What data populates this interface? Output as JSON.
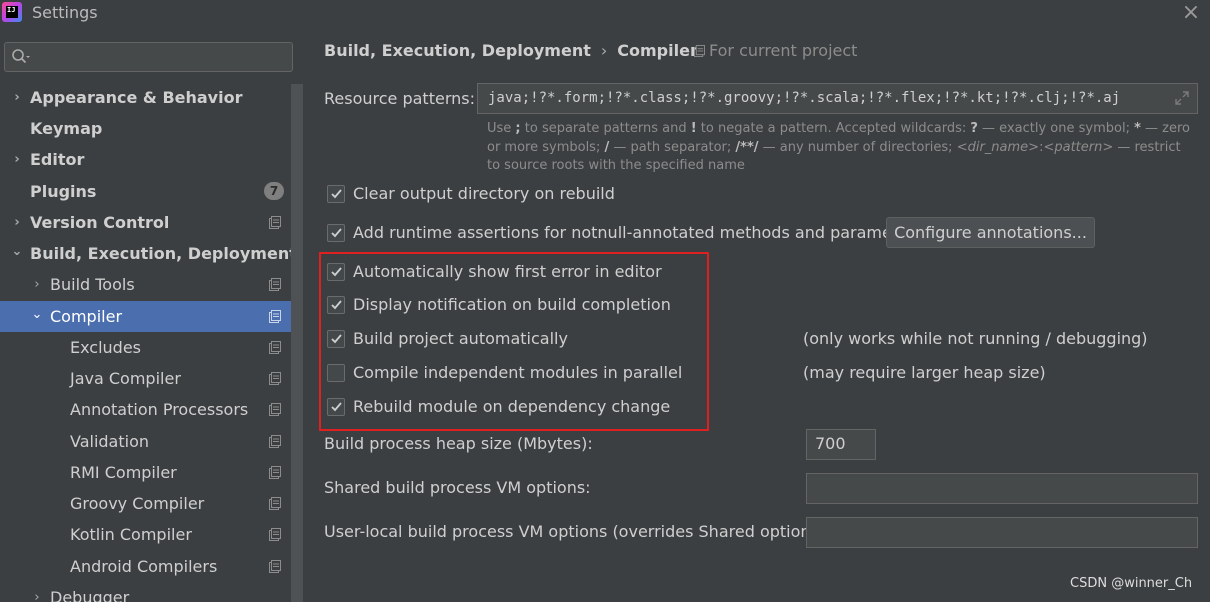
{
  "window": {
    "title": "Settings",
    "app_icon_text": "IJ"
  },
  "search": {
    "placeholder": ""
  },
  "sidebar": {
    "items": [
      {
        "label": "Appearance & Behavior",
        "chevron": "›",
        "badge": ""
      },
      {
        "label": "Keymap",
        "chevron": "",
        "badge": ""
      },
      {
        "label": "Editor",
        "chevron": "›",
        "badge": ""
      },
      {
        "label": "Plugins",
        "chevron": "",
        "badge": "7"
      },
      {
        "label": "Version Control",
        "chevron": "›",
        "badge": ""
      },
      {
        "label": "Build, Execution, Deployment",
        "chevron": "⌄",
        "badge": ""
      },
      {
        "label": "Build Tools",
        "chevron": "›",
        "badge": ""
      },
      {
        "label": "Compiler",
        "chevron": "⌄",
        "badge": ""
      },
      {
        "label": "Excludes",
        "chevron": "",
        "badge": ""
      },
      {
        "label": "Java Compiler",
        "chevron": "",
        "badge": ""
      },
      {
        "label": "Annotation Processors",
        "chevron": "",
        "badge": ""
      },
      {
        "label": "Validation",
        "chevron": "",
        "badge": ""
      },
      {
        "label": "RMI Compiler",
        "chevron": "",
        "badge": ""
      },
      {
        "label": "Groovy Compiler",
        "chevron": "",
        "badge": ""
      },
      {
        "label": "Kotlin Compiler",
        "chevron": "",
        "badge": ""
      },
      {
        "label": "Android Compilers",
        "chevron": "",
        "badge": ""
      },
      {
        "label": "Debugger",
        "chevron": "›",
        "badge": ""
      }
    ]
  },
  "main": {
    "breadcrumb": [
      "Build, Execution, Deployment",
      "Compiler"
    ],
    "breadcrumb_sep": "›",
    "for_current_project": "For current project",
    "resource_patterns_label": "Resource patterns:",
    "resource_patterns_value": "java;!?*.form;!?*.class;!?*.groovy;!?*.scala;!?*.flex;!?*.kt;!?*.clj;!?*.aj",
    "help": {
      "p1": "Use ",
      "semi": ";",
      "p2": " to separate patterns and ",
      "bang": "!",
      "p3": " to negate a pattern. Accepted wildcards: ",
      "q": "?",
      "p4": " — exactly one symbol; ",
      "star": "*",
      "p5": " — zero or more symbols; ",
      "slash": "/",
      "p6": " — path separator; ",
      "dstar": "/**/",
      "p7": " — any number of directories; ",
      "dir": "<dir_name>",
      "colon": ":",
      "pat": "<pattern>",
      "p8": " — restrict to source roots with the specified name"
    },
    "checkboxes": [
      {
        "label": "Clear output directory on rebuild",
        "checked": true
      },
      {
        "label": "Add runtime assertions for notnull-annotated methods and parameters",
        "checked": true
      },
      {
        "label": "Automatically show first error in editor",
        "checked": true
      },
      {
        "label": "Display notification on build completion",
        "checked": true
      },
      {
        "label": "Build project automatically",
        "checked": true
      },
      {
        "label": "Compile independent modules in parallel",
        "checked": false
      },
      {
        "label": "Rebuild module on dependency change",
        "checked": true
      }
    ],
    "configure_annotations_button": "Configure annotations...",
    "hint_build_auto": "(only works while not running / debugging)",
    "hint_parallel": "(may require larger heap size)",
    "heap_label": "Build process heap size (Mbytes):",
    "heap_value": "700",
    "shared_vm_label": "Shared build process VM options:",
    "shared_vm_value": "",
    "user_vm_label": "User-local build process VM options (overrides Shared options):",
    "user_vm_value": ""
  },
  "watermark": "CSDN @winner_Ch"
}
